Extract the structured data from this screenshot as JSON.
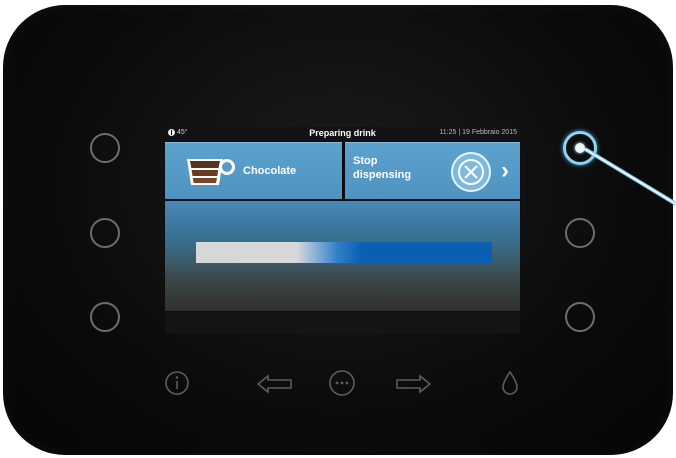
{
  "statusbar": {
    "temperature": "45°",
    "title": "Preparing drink",
    "datetime": "11:25 | 19 Febbraio 2015"
  },
  "tiles": {
    "drink_label": "Chocolate",
    "stop_label_line1": "Stop",
    "stop_label_line2": "dispensing",
    "chevron": "›"
  },
  "progress": {
    "value": 0.34
  },
  "icons": {
    "drink": "chocolate-cup-icon",
    "stop": "cancel-x-icon",
    "temperature": "thermometer-icon",
    "info": "info-icon",
    "left": "arrow-left-icon",
    "menu": "more-dots-icon",
    "right": "arrow-right-icon",
    "water": "drop-icon"
  },
  "colors": {
    "panel": "#0b0b0c",
    "tile": "#5597c5",
    "progress_fill": "#0a5fb3",
    "progress_track": "#d6d7d9",
    "highlight": "#8fd3f2"
  }
}
